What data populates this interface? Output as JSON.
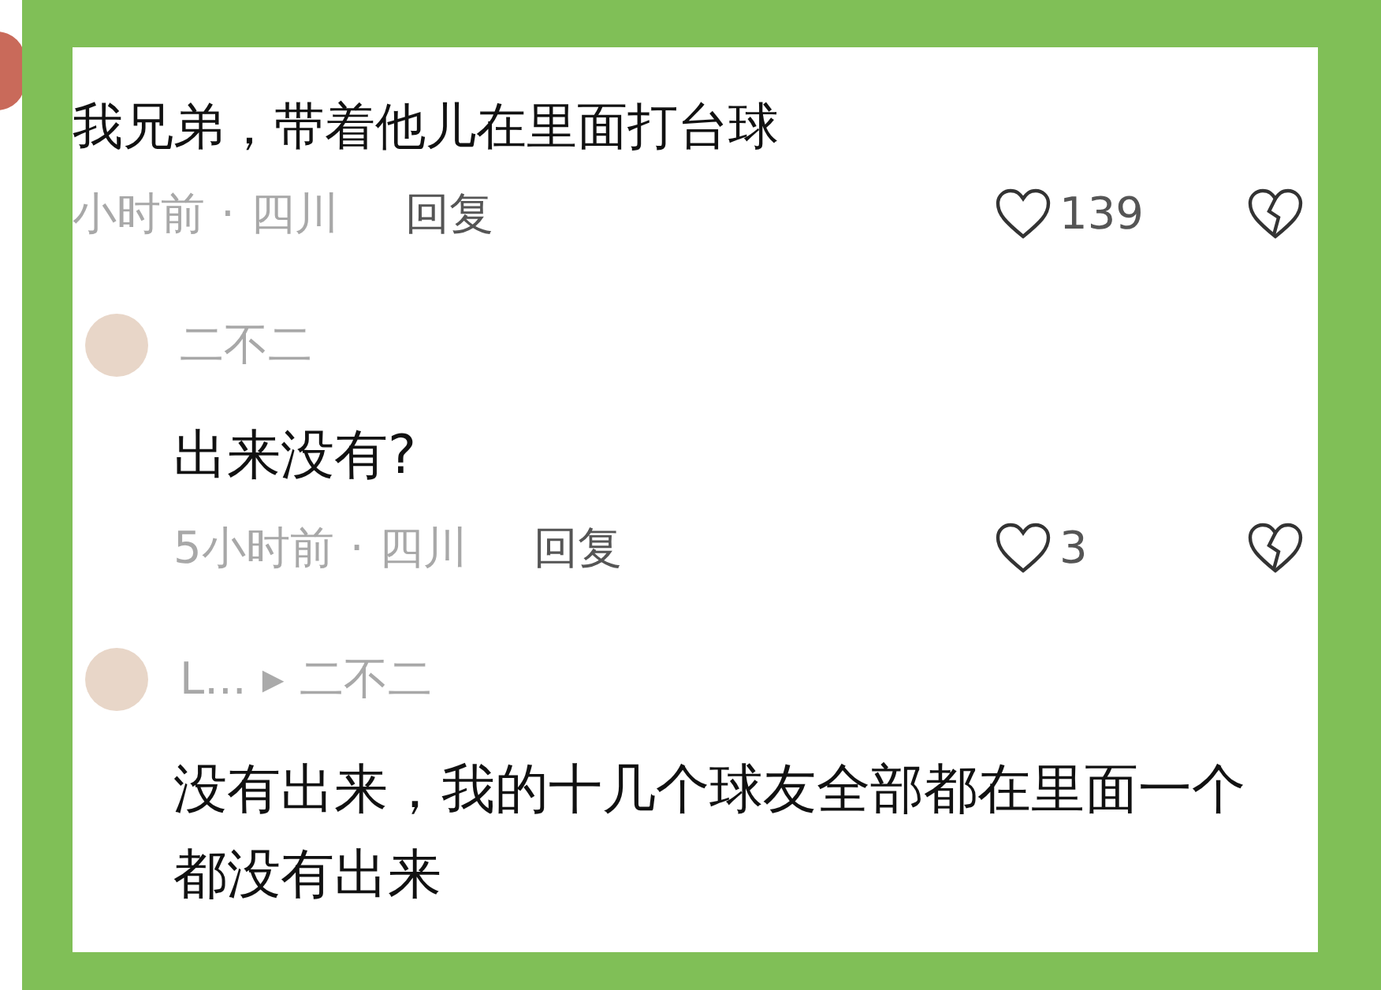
{
  "comments": [
    {
      "kind": "top",
      "text": "我兄弟，带着他儿在里面打台球",
      "time": "小时前",
      "separator": "·",
      "location": "四川",
      "reply_label": "回复",
      "likes": "139"
    },
    {
      "kind": "reply",
      "author": "二不二",
      "text": "出来没有?",
      "time": "5小时前",
      "separator": "·",
      "location": "四川",
      "reply_label": "回复",
      "likes": "3"
    },
    {
      "kind": "reply",
      "author": "L...",
      "reply_to": "二不二",
      "arrow": "▶",
      "text": "没有出来，我的十几个球友全部都在里面一个都没有出来"
    }
  ]
}
